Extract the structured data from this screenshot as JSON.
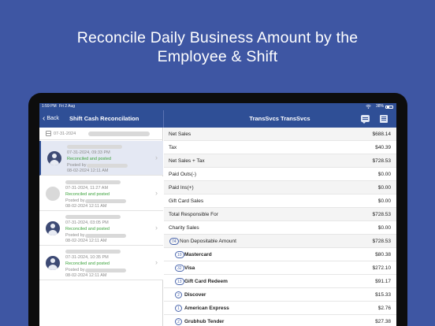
{
  "headline": {
    "line1": "Reconcile Daily Business Amount by the",
    "line2": "Employee & Shift"
  },
  "status_bar": {
    "time": "1:59 PM",
    "date": "Fri 2 Aug",
    "battery": "38%"
  },
  "nav": {
    "back_label": "Back",
    "left_title": "Shift Cash Reconcilation",
    "right_title": "TransSvcs TransSvcs",
    "chat_icon": "chat-bubble-icon",
    "report_icon": "report-list-icon"
  },
  "left_pane": {
    "filter_date": "07-31-2024",
    "items": [
      {
        "time": "07-31-2024, 09:33 PM",
        "status": "Reconciled and posted",
        "posted_by_label": "Posted by",
        "posted_time": "08-02-2024 12:11 AM",
        "avatar": "person-icon",
        "selected": true
      },
      {
        "time": "07-31-2024, 11:27 AM",
        "status": "Reconciled and posted",
        "posted_by_label": "Posted by",
        "posted_time": "08-02-2024 12:11 AM",
        "avatar": "blank",
        "selected": false
      },
      {
        "time": "07-31-2024, 03:05 PM",
        "status": "Reconciled and posted",
        "posted_by_label": "Posted by",
        "posted_time": "08-02-2024 12:11 AM",
        "avatar": "person-icon",
        "selected": false
      },
      {
        "time": "07-31-2024, 10:35 PM",
        "status": "Reconciled and posted",
        "posted_by_label": "Posted by",
        "posted_time": "08-02-2024 12:11 AM",
        "avatar": "person-icon",
        "selected": false
      }
    ]
  },
  "right_pane": {
    "rows": [
      {
        "label": "Net Sales",
        "value": "$688.14"
      },
      {
        "label": "Tax",
        "value": "$40.39"
      },
      {
        "label": "Net Sales + Tax",
        "value": "$728.53"
      },
      {
        "label": "Paid Outs(-)",
        "value": "$0.00"
      },
      {
        "label": "Paid Ins(+)",
        "value": "$0.00"
      },
      {
        "label": "Gift Card Sales",
        "value": "$0.00"
      },
      {
        "label": "Total Responsible For",
        "value": "$728.53"
      },
      {
        "label": "Charity Sales",
        "value": "$0.00"
      },
      {
        "label": "Non Depositable Amount",
        "value": "$728.53",
        "badge": "74"
      },
      {
        "label": "Mastercard",
        "value": "$80.38",
        "badge": "10"
      },
      {
        "label": "Visa",
        "value": "$272.10",
        "badge": "32"
      },
      {
        "label": "Gift Card Redeem",
        "value": "$91.17",
        "badge": "13"
      },
      {
        "label": "Discover",
        "value": "$15.33",
        "badge": "2"
      },
      {
        "label": "American Express",
        "value": "$2.76",
        "badge": "1"
      },
      {
        "label": "Grubhub Tender",
        "value": "$27.38",
        "badge": "2"
      }
    ]
  },
  "colors": {
    "background": "#3e56a3",
    "nav": "#2f4f96",
    "status_green": "#3aa23a",
    "badge_blue": "#4a66ad"
  }
}
